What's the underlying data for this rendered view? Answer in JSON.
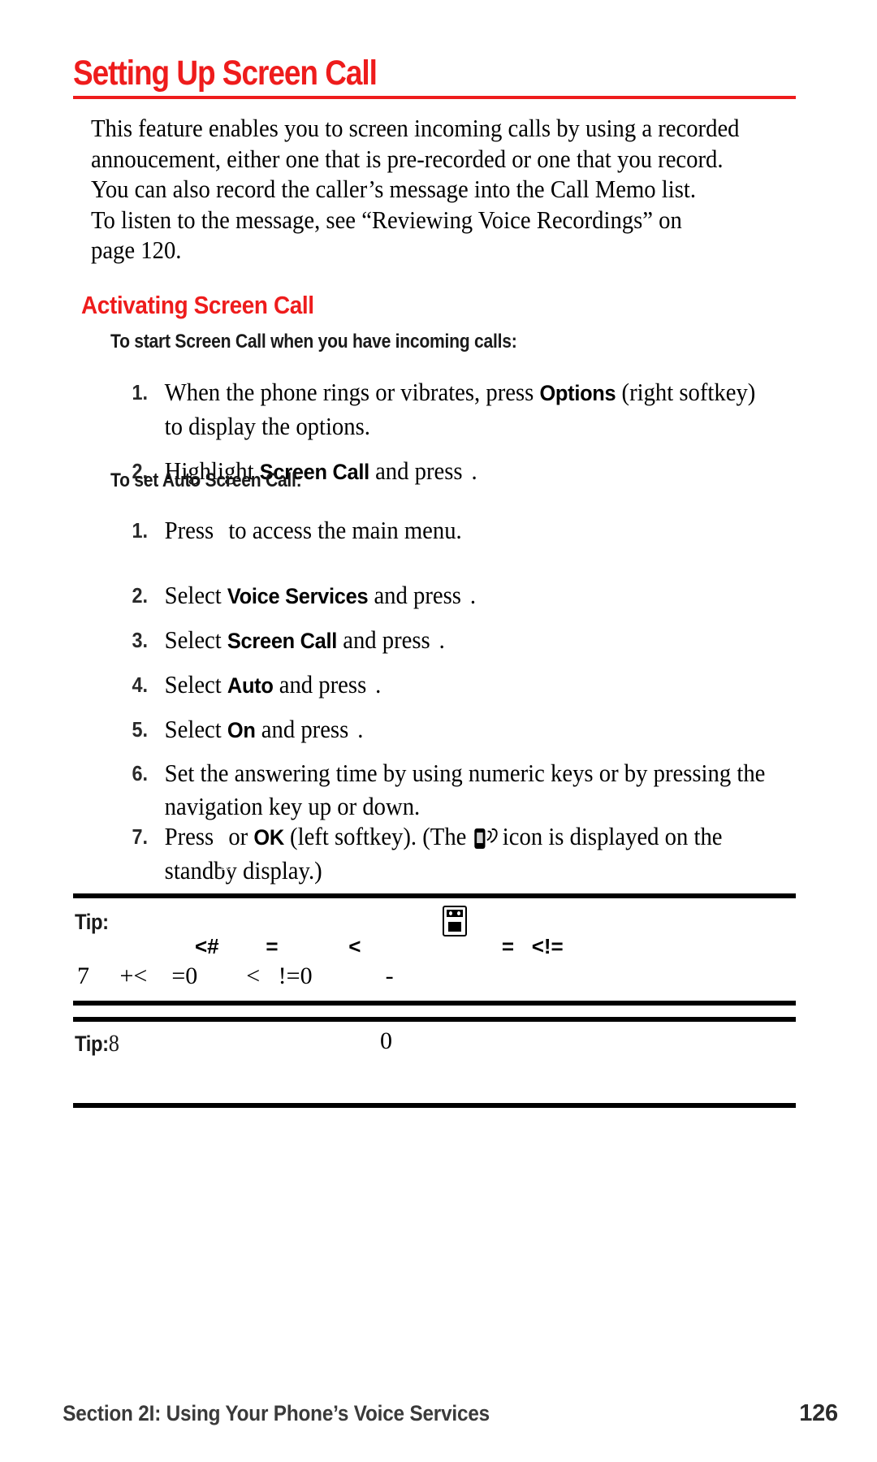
{
  "colors": {
    "accent_red": "#ee1c1c",
    "text": "#000000",
    "rule": "#000000"
  },
  "heading": {
    "title": "Setting Up Screen Call"
  },
  "intro": {
    "lines": [
      "This feature enables you to screen incoming calls by using a recorded",
      "annoucement, either one that is pre-recorded or one that you record.",
      "You can also record the caller’s message into the Call Memo list.",
      "To listen to the message, see “Reviewing Voice Recordings” on",
      "page 120."
    ]
  },
  "subheading": {
    "title": "Activating Screen Call"
  },
  "section_start": {
    "title": "To start Screen Call when you have incoming calls:",
    "steps": [
      {
        "num": "1.",
        "parts": [
          {
            "t": "text",
            "v": "When the phone rings or vibrates, press "
          },
          {
            "t": "bold",
            "v": "Options"
          },
          {
            "t": "text",
            "v": " (right softkey)"
          },
          {
            "t": "break"
          },
          {
            "t": "text",
            "v": "to display the options."
          }
        ]
      },
      {
        "num": "2.",
        "parts": [
          {
            "t": "text",
            "v": "Highlight "
          },
          {
            "t": "bold",
            "v": "Screen Call"
          },
          {
            "t": "text",
            "v": " and press "
          },
          {
            "t": "icon",
            "v": "menu-ok-key-icon"
          },
          {
            "t": "text",
            "v": "."
          }
        ]
      }
    ]
  },
  "section_auto": {
    "title": "To set Auto Screen Call:",
    "steps": [
      {
        "num": "1.",
        "parts": [
          {
            "t": "text",
            "v": "Press "
          },
          {
            "t": "icon",
            "v": "menu-ok-key-icon"
          },
          {
            "t": "text",
            "v": " to access the main menu."
          }
        ]
      },
      {
        "num": "2.",
        "parts": [
          {
            "t": "text",
            "v": "Select "
          },
          {
            "t": "bold",
            "v": "Voice Services"
          },
          {
            "t": "text",
            "v": " and press "
          },
          {
            "t": "icon",
            "v": "menu-ok-key-icon"
          },
          {
            "t": "text",
            "v": "."
          }
        ]
      },
      {
        "num": "3.",
        "parts": [
          {
            "t": "text",
            "v": "Select "
          },
          {
            "t": "bold",
            "v": "Screen Call"
          },
          {
            "t": "text",
            "v": " and press "
          },
          {
            "t": "icon",
            "v": "menu-ok-key-icon"
          },
          {
            "t": "text",
            "v": "."
          }
        ]
      },
      {
        "num": "4.",
        "parts": [
          {
            "t": "text",
            "v": "Select "
          },
          {
            "t": "bold",
            "v": "Auto"
          },
          {
            "t": "text",
            "v": " and press "
          },
          {
            "t": "icon",
            "v": "menu-ok-key-icon"
          },
          {
            "t": "text",
            "v": "."
          }
        ]
      },
      {
        "num": "5.",
        "parts": [
          {
            "t": "text",
            "v": "Select "
          },
          {
            "t": "bold",
            "v": "On"
          },
          {
            "t": "text",
            "v": " and press "
          },
          {
            "t": "icon",
            "v": "menu-ok-key-icon"
          },
          {
            "t": "text",
            "v": "."
          }
        ]
      },
      {
        "num": "6.",
        "parts": [
          {
            "t": "text",
            "v": "Set the answering time by using numeric keys or by pressing the"
          },
          {
            "t": "break"
          },
          {
            "t": "text",
            "v": "navigation key up or down."
          }
        ]
      },
      {
        "num": "7.",
        "parts": [
          {
            "t": "text",
            "v": "Press "
          },
          {
            "t": "icon",
            "v": "menu-ok-key-icon"
          },
          {
            "t": "text",
            "v": " or "
          },
          {
            "t": "bold",
            "v": "OK"
          },
          {
            "t": "text",
            "v": " (left softkey). (The "
          },
          {
            "t": "icon",
            "v": "screen-call-standby-icon"
          },
          {
            "t": "text",
            "v": " icon is displayed on the"
          },
          {
            "t": "break"
          },
          {
            "t": "text",
            "v": "standby display.)"
          }
        ]
      }
    ]
  },
  "tips": [
    {
      "label": "Tip:",
      "icon": "phone-handset-icon",
      "line1": "<#        =            <                        =   <!=",
      "line2": "7     +<    =0        <   !=0            -"
    },
    {
      "label": "Tip:",
      "value": "8",
      "mid": "0",
      "talk_icon": "talk-key-icon",
      "end_icon": "end-key-icon"
    }
  ],
  "footer": {
    "section": "Section 2I: Using Your Phone’s Voice Services",
    "page": "126"
  }
}
